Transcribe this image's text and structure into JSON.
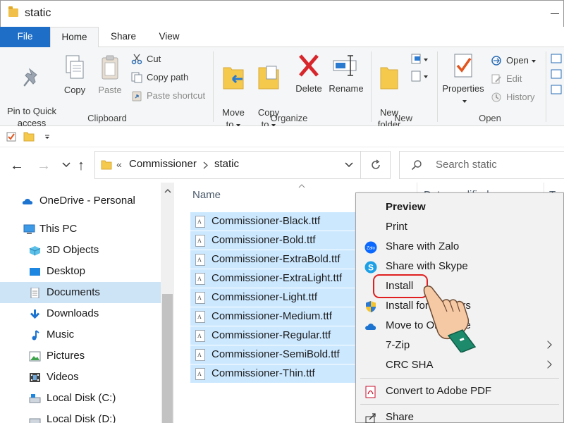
{
  "window": {
    "title": "static"
  },
  "ribbon_tabs": [
    "File",
    "Home",
    "Share",
    "View"
  ],
  "ribbon": {
    "clipboard": {
      "pin": "Pin to Quick\naccess",
      "copy": "Copy",
      "paste": "Paste",
      "cut": "Cut",
      "copy_path": "Copy path",
      "paste_shortcut": "Paste shortcut",
      "label": "Clipboard"
    },
    "organize": {
      "move_to": "Move\nto",
      "copy_to": "Copy\nto",
      "delete": "Delete",
      "rename": "Rename",
      "label": "Organize"
    },
    "new": {
      "new_folder": "New\nfolder",
      "label": "New"
    },
    "open": {
      "properties": "Properties",
      "open": "Open",
      "edit": "Edit",
      "history": "History",
      "label": "Open"
    }
  },
  "address": {
    "chevrons": "«",
    "path": [
      "Commissioner",
      "static"
    ],
    "search_placeholder": "Search static"
  },
  "nav_pane": [
    {
      "label": "OneDrive - Personal",
      "icon": "cloud-icon"
    },
    {
      "label": "This PC",
      "icon": "computer-icon"
    },
    {
      "label": "3D Objects",
      "icon": "cube-icon"
    },
    {
      "label": "Desktop",
      "icon": "desktop-icon"
    },
    {
      "label": "Documents",
      "icon": "document-icon",
      "selected": true
    },
    {
      "label": "Downloads",
      "icon": "download-icon"
    },
    {
      "label": "Music",
      "icon": "music-icon"
    },
    {
      "label": "Pictures",
      "icon": "picture-icon"
    },
    {
      "label": "Videos",
      "icon": "video-icon"
    },
    {
      "label": "Local Disk (C:)",
      "icon": "disk-icon"
    },
    {
      "label": "Local Disk (D:)",
      "icon": "disk-icon"
    }
  ],
  "columns": {
    "name": "Name",
    "date_modified": "Date modified",
    "type": "Type"
  },
  "files": [
    "Commissioner-Black.ttf",
    "Commissioner-Bold.ttf",
    "Commissioner-ExtraBold.ttf",
    "Commissioner-ExtraLight.ttf",
    "Commissioner-Light.ttf",
    "Commissioner-Medium.ttf",
    "Commissioner-Regular.ttf",
    "Commissioner-SemiBold.ttf",
    "Commissioner-Thin.ttf"
  ],
  "context_menu": {
    "preview": "Preview",
    "print": "Print",
    "share_zalo": "Share with Zalo",
    "share_skype": "Share with Skype",
    "install": "Install",
    "install_all_users": "Install for all users",
    "move_to_onedrive": "Move to OneDrive",
    "seven_zip": "7-Zip",
    "crc_sha": "CRC SHA",
    "convert_pdf": "Convert to Adobe PDF",
    "share": "Share"
  },
  "colors": {
    "accent": "#1e6ec8",
    "selection": "#cce8ff",
    "highlight_ring": "#e02020"
  }
}
